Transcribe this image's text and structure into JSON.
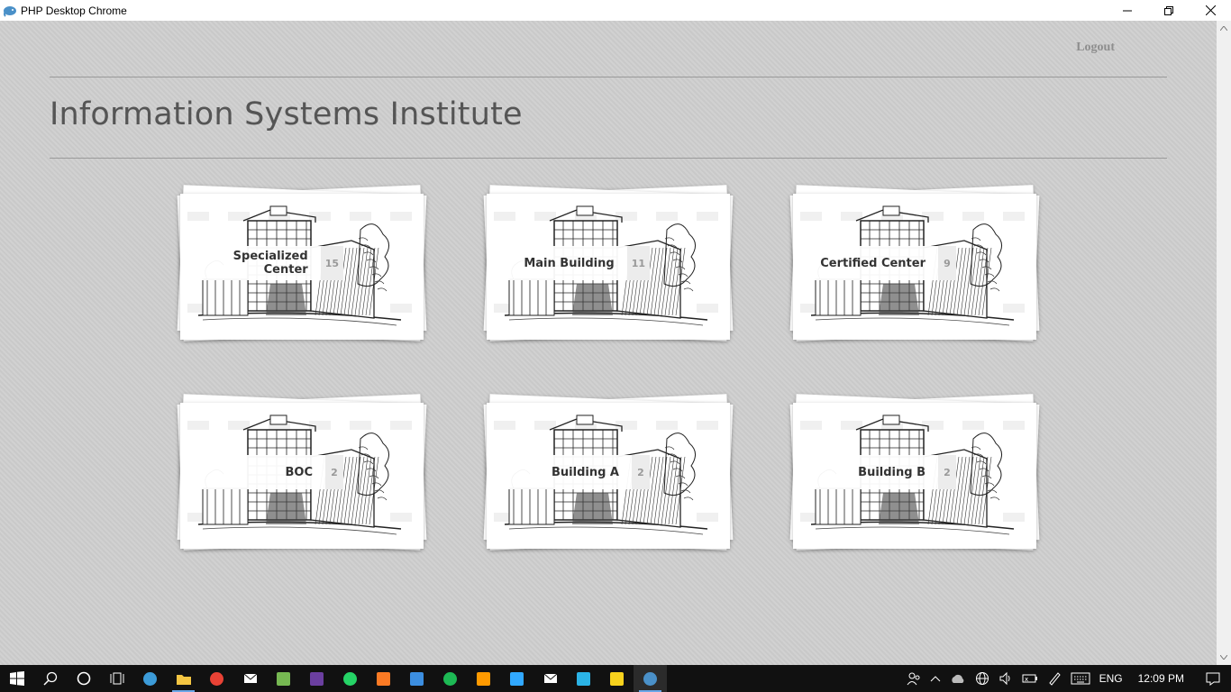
{
  "window": {
    "title": "PHP Desktop Chrome",
    "icon": "php-elephant-icon"
  },
  "header": {
    "logout_label": "Logout",
    "page_title": "Information Systems Institute"
  },
  "buildings": [
    {
      "name": "Specialized Center",
      "count": "15"
    },
    {
      "name": "Main Building",
      "count": "11"
    },
    {
      "name": "Certified Center",
      "count": "9"
    },
    {
      "name": "BOC",
      "count": "2"
    },
    {
      "name": "Building A",
      "count": "2"
    },
    {
      "name": "Building B",
      "count": "2"
    }
  ],
  "taskbar": {
    "apps": [
      "start-icon",
      "search-icon",
      "cortana-icon",
      "task-view-icon",
      "edge-icon",
      "file-explorer-icon",
      "chrome-icon",
      "mail-icon",
      "utorrent-icon",
      "phpstorm-icon",
      "whatsapp-icon",
      "xampp-icon",
      "recycle-app-icon",
      "spotify-icon",
      "illustrator-icon",
      "photoshop-icon",
      "notion-icon",
      "remote-desktop-icon",
      "sticky-notes-icon",
      "php-desktop-icon"
    ],
    "language": "ENG",
    "time": "12:09 PM"
  },
  "colors": {
    "background": "#d0d0d0",
    "title": "#555555",
    "logout": "#8e8e8e",
    "taskbar": "#111111"
  }
}
